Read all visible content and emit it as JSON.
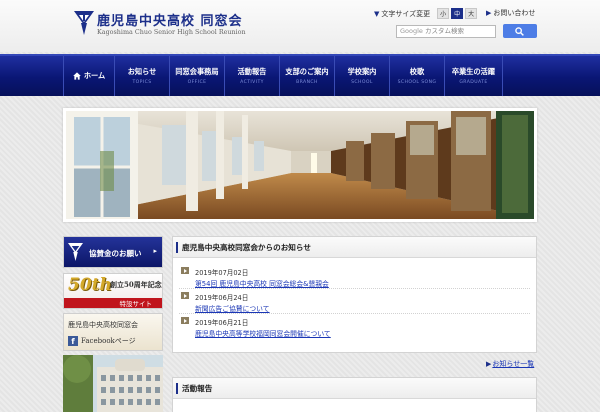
{
  "header": {
    "title": "鹿児島中央高校 同窓会",
    "subtitle": "Kagoshima Chuo Senior High School Reunion",
    "font_size_label": "文字サイズ変更",
    "font_sizes": [
      "小",
      "中",
      "大"
    ],
    "contact_label": "お問い合わせ",
    "search": {
      "google": "Google",
      "placeholder": "カスタム検索"
    }
  },
  "nav": [
    {
      "label": "ホーム",
      "sub": "",
      "icon": "home-icon"
    },
    {
      "label": "お知らせ",
      "sub": "TOPICS"
    },
    {
      "label": "同窓会事務局",
      "sub": "OFFICE"
    },
    {
      "label": "活動報告",
      "sub": "ACTIVITY"
    },
    {
      "label": "支部のご案内",
      "sub": "BRANCH"
    },
    {
      "label": "学校案内",
      "sub": "SCHOOL"
    },
    {
      "label": "校歌",
      "sub": "SCHOOL SONG"
    },
    {
      "label": "卒業生の活躍",
      "sub": "GRADUATE"
    }
  ],
  "sidebar": {
    "donation": "協賛金のお願い",
    "anniversary_big": "50th",
    "anniversary_title": "創立50周年記念",
    "anniversary_site": "特設サイト",
    "facebook_line1": "鹿児島中央高校同窓会",
    "facebook_line2": "Facebookページ"
  },
  "news": {
    "title": "鹿児島中央高校同窓会からのお知らせ",
    "items": [
      {
        "date": "2019年07月02日",
        "text": "第54回 鹿児島中央高校 同窓会総会&懇親会"
      },
      {
        "date": "2019年06月24日",
        "text": "新聞広告ご協賛について"
      },
      {
        "date": "2019年06月21日",
        "text": "鹿児島中央高等学校福岡同窓会開催について"
      }
    ],
    "more": "お知らせ一覧"
  },
  "activity": {
    "title": "活動報告"
  },
  "colors": {
    "brand": "#1c2f8a",
    "nav": "#0a1674",
    "link": "#1a36b5",
    "accent_red": "#c0141c"
  }
}
